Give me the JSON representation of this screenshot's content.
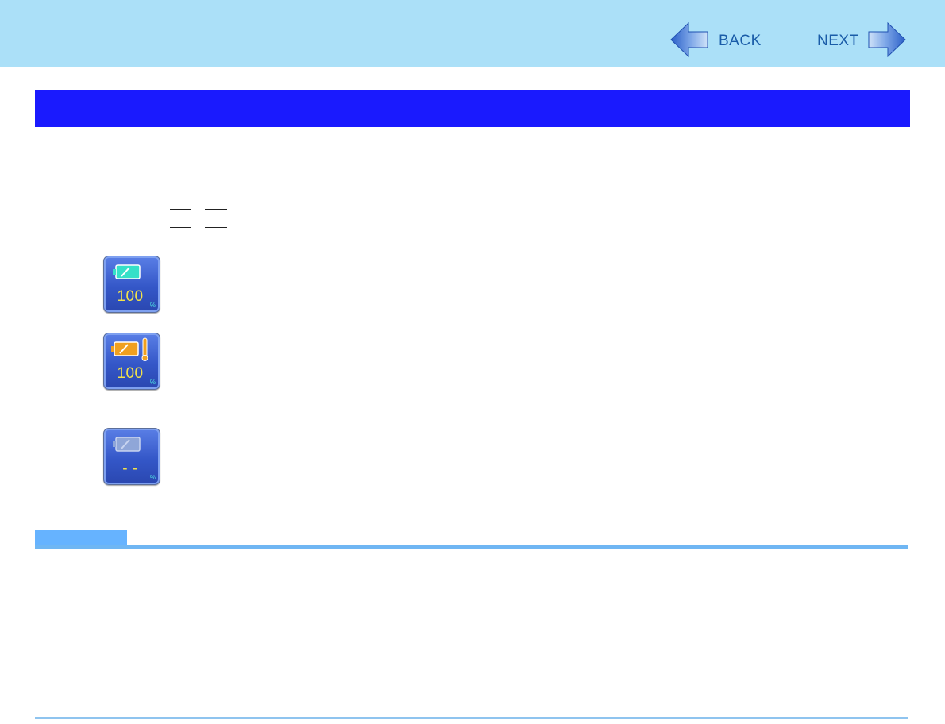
{
  "header": {
    "back_label": "BACK",
    "next_label": "NEXT"
  },
  "battery_states": [
    {
      "value": "100",
      "unit": "%",
      "icon": "battery-full-icon",
      "color": "#36e0c8"
    },
    {
      "value": "100",
      "unit": "%",
      "icon": "battery-high-temperature-icon",
      "color": "#f0a020"
    },
    {
      "value": "- -",
      "unit": "%",
      "icon": "battery-not-detected-icon",
      "color": "#8fa6d8"
    }
  ],
  "colors": {
    "header_bg": "#abe0f8",
    "title_bar": "#1a1afe",
    "note_accent": "#66b3ff",
    "nav_text": "#1a5ca8"
  }
}
